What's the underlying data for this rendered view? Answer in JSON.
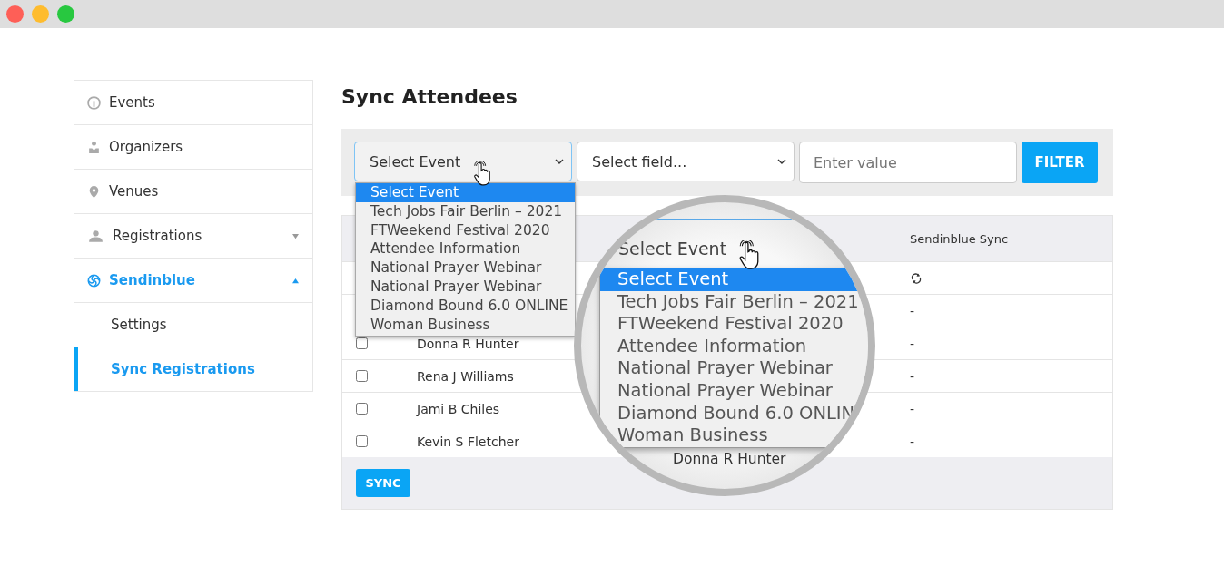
{
  "window": {
    "controls": [
      {
        "color": "#fe5f57"
      },
      {
        "color": "#febc2e"
      },
      {
        "color": "#28c840"
      }
    ]
  },
  "sidebar": {
    "items": [
      {
        "label": "Events",
        "kind": "link"
      },
      {
        "label": "Organizers",
        "kind": "link"
      },
      {
        "label": "Venues",
        "kind": "link"
      },
      {
        "label": "Registrations",
        "kind": "group",
        "expanded": false,
        "selected": false
      },
      {
        "label": "Sendinblue",
        "kind": "group",
        "expanded": true,
        "selected": true,
        "children": [
          {
            "label": "Settings",
            "selected": false
          },
          {
            "label": "Sync Registrations",
            "selected": true
          }
        ]
      }
    ]
  },
  "page": {
    "title": "Sync Attendees"
  },
  "filter": {
    "event_select": {
      "value": "Select Event",
      "open": true
    },
    "field_select": {
      "value": "Select field..."
    },
    "value_input": {
      "placeholder": "Enter value"
    },
    "button": "FILTER"
  },
  "dropdown": {
    "options": [
      {
        "label": "Select Event",
        "selected": true
      },
      {
        "label": "Tech Jobs Fair Berlin – 2021",
        "selected": false
      },
      {
        "label": "FTWeekend Festival 2020",
        "selected": false
      },
      {
        "label": "Attendee Information",
        "selected": false
      },
      {
        "label": "National Prayer Webinar",
        "selected": false
      },
      {
        "label": "National Prayer Webinar",
        "selected": false
      },
      {
        "label": "Diamond Bound 6.0 ONLINE",
        "selected": false
      },
      {
        "label": "Woman Business",
        "selected": false
      }
    ]
  },
  "table": {
    "columns": [
      {
        "label": "Sendinblue Sync"
      }
    ],
    "rows": [
      {
        "kind": "icon"
      },
      {
        "kind": "text",
        "status": "-"
      },
      {
        "name": "Donna R Hunter",
        "checked": false,
        "kind": "text",
        "status": "-"
      },
      {
        "name": "Rena J Williams",
        "checked": false,
        "kind": "text",
        "status": "-"
      },
      {
        "name": "Jami B Chiles",
        "checked": false,
        "kind": "text",
        "status": "-"
      },
      {
        "name": "Kevin S Fletcher",
        "checked": false,
        "kind": "text",
        "status": "-"
      }
    ],
    "button": "SYNC"
  },
  "magnifier": {
    "field_text": "Select Event",
    "options": [
      {
        "label": "Select Event",
        "selected": true
      },
      {
        "label": "Tech Jobs Fair Berlin – 2021",
        "selected": false
      },
      {
        "label": "FTWeekend Festival 2020",
        "selected": false
      },
      {
        "label": "Attendee Information",
        "selected": false
      },
      {
        "label": "National Prayer Webinar",
        "selected": false
      },
      {
        "label": "National Prayer Webinar",
        "selected": false
      },
      {
        "label": "Diamond Bound 6.0 ONLIN",
        "selected": false
      },
      {
        "label": "Woman Business",
        "selected": false
      }
    ],
    "row_text": "Donna R Hunter"
  }
}
